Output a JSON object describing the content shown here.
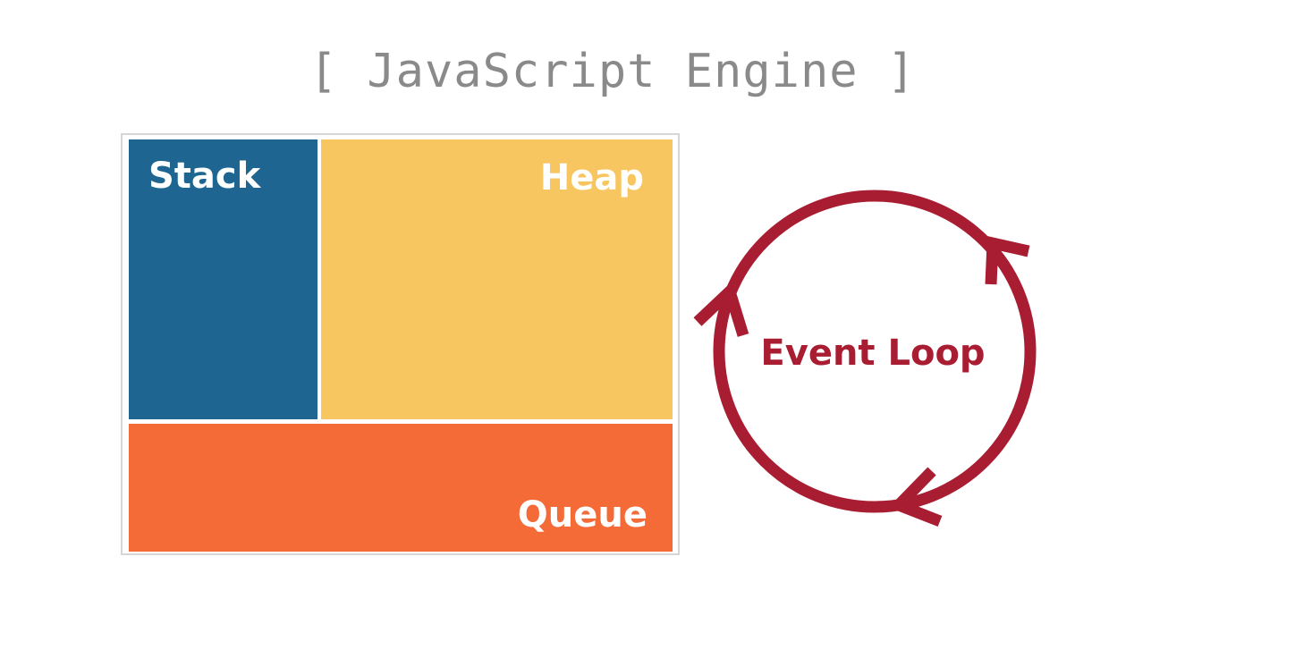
{
  "title": "[ JavaScript Engine ]",
  "engine": {
    "stack": {
      "label": "Stack",
      "color": "#1f6591"
    },
    "heap": {
      "label": "Heap",
      "color": "#f8c660"
    },
    "queue": {
      "label": "Queue",
      "color": "#f46b38"
    }
  },
  "event_loop": {
    "label": "Event Loop",
    "color": "#a81d32"
  }
}
